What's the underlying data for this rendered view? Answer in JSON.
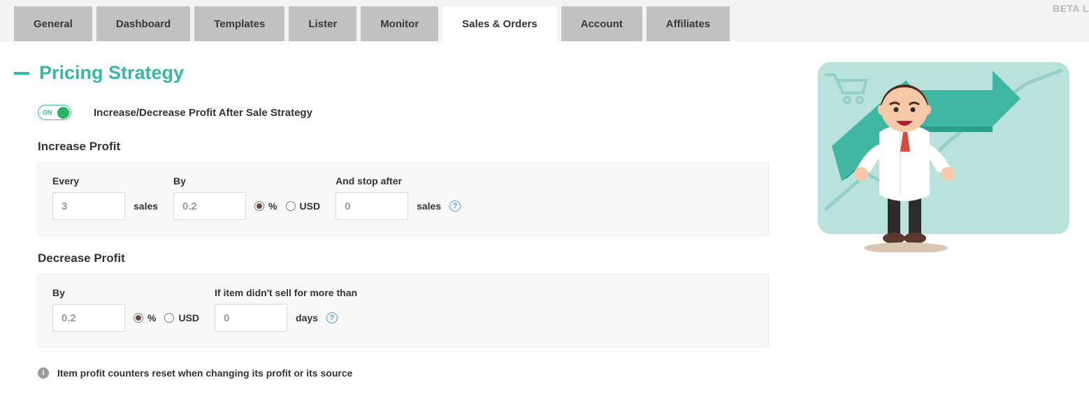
{
  "header": {
    "beta": "BETA L"
  },
  "tabs": [
    "General",
    "Dashboard",
    "Templates",
    "Lister",
    "Monitor",
    "Sales & Orders",
    "Account",
    "Affiliates"
  ],
  "section": {
    "title": "Pricing Strategy",
    "toggle_label": "ON",
    "strategy_name": "Increase/Decrease Profit After Sale Strategy"
  },
  "units": {
    "percent": "%",
    "usd": "USD"
  },
  "increase": {
    "heading": "Increase Profit",
    "every_label": "Every",
    "every_value": "3",
    "every_unit": "sales",
    "by_label": "By",
    "by_value": "0.2",
    "stop_label": "And stop after",
    "stop_value": "0",
    "stop_unit": "sales"
  },
  "decrease": {
    "heading": "Decrease Profit",
    "by_label": "By",
    "by_value": "0.2",
    "if_label": "If item didn't sell for more than",
    "days_value": "0",
    "days_unit": "days"
  },
  "note": "Item profit counters reset when changing its profit or its source"
}
